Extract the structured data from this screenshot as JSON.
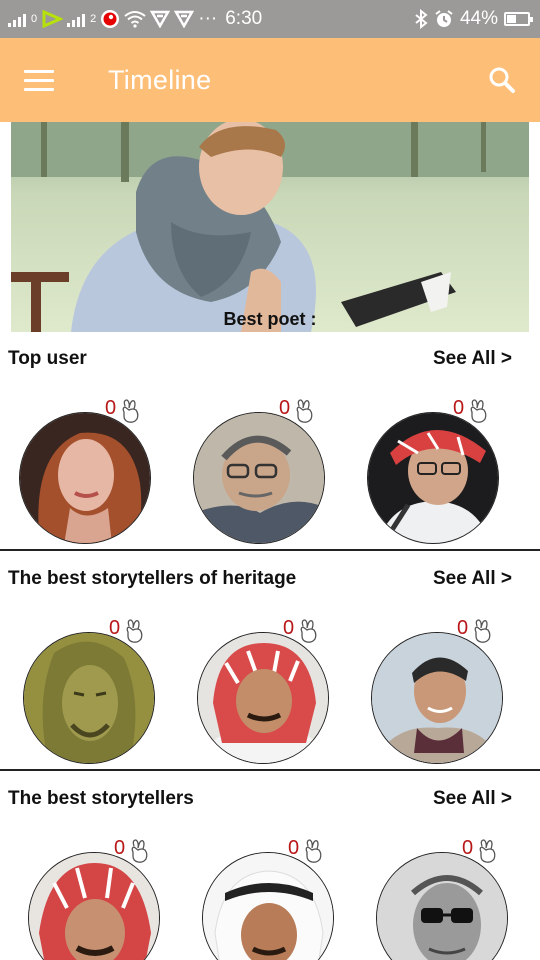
{
  "status_bar": {
    "carrier_small_1": "0",
    "carrier_small_2": "2",
    "dots": "···",
    "time": "6:30",
    "battery": "44%",
    "battery_level": 0.44
  },
  "app_bar": {
    "title": "Timeline",
    "menu_icon": "hamburger-menu-icon",
    "search_icon": "search-icon"
  },
  "banner": {
    "caption": "Best poet :"
  },
  "sections": [
    {
      "title": "Top user",
      "see_all": "See All >",
      "users": [
        {
          "likes": "0"
        },
        {
          "likes": "0"
        },
        {
          "likes": "0"
        }
      ]
    },
    {
      "title": "The best storytellers of heritage",
      "see_all": "See All >",
      "users": [
        {
          "likes": "0"
        },
        {
          "likes": "0"
        },
        {
          "likes": "0"
        }
      ]
    },
    {
      "title": "The best storytellers",
      "see_all": "See All >",
      "users": [
        {
          "likes": "0"
        },
        {
          "likes": "0"
        },
        {
          "likes": "0"
        }
      ]
    }
  ],
  "colors": {
    "app_bar": "#fdbf78",
    "status_bar": "#9c9a98",
    "like_count": "#b81818"
  }
}
